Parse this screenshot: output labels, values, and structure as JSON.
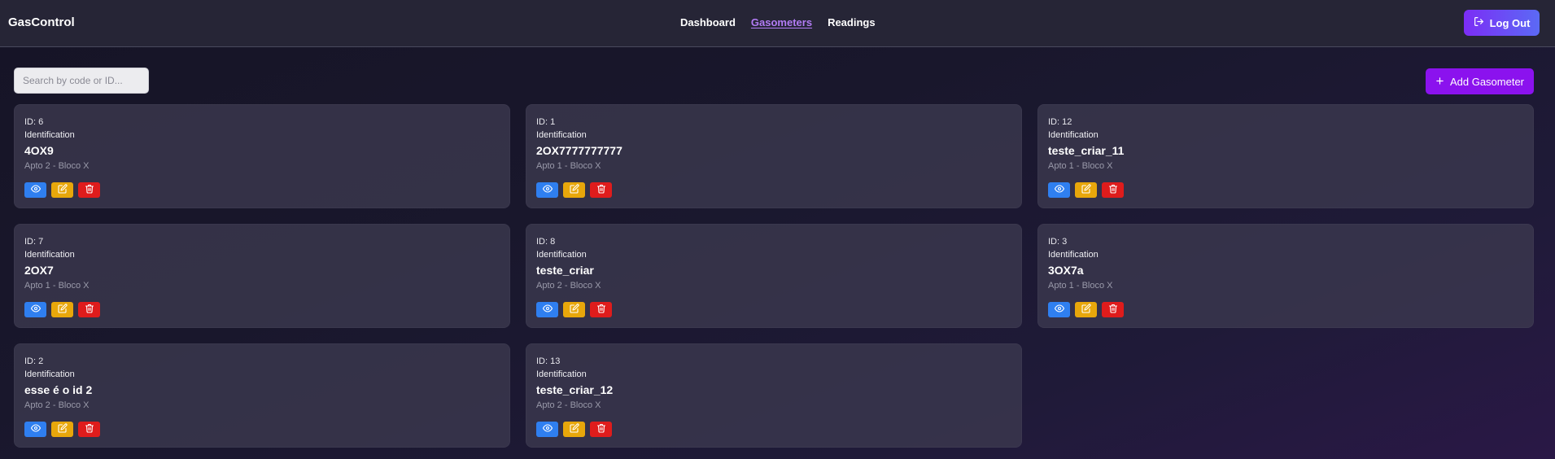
{
  "app": {
    "brand": "GasControl"
  },
  "nav": {
    "items": [
      {
        "label": "Dashboard",
        "active": false
      },
      {
        "label": "Gasometers",
        "active": true
      },
      {
        "label": "Readings",
        "active": false
      }
    ]
  },
  "header": {
    "logout_label": "Log Out",
    "logout_icon": "log-out-icon"
  },
  "toolbar": {
    "search_placeholder": "Search by code or ID...",
    "search_value": "",
    "add_label": "Add Gasometer",
    "add_icon": "plus-icon"
  },
  "colors": {
    "accent": "#8b12ee",
    "view": "#2f7ff0",
    "edit": "#e8a70b",
    "delete": "#df1c1c",
    "active_nav": "#b37cf5"
  },
  "cards": [
    {
      "id": "ID: 6",
      "ident_label": "Identification",
      "code": "4OX9",
      "location": "Apto 2 - Bloco X"
    },
    {
      "id": "ID: 1",
      "ident_label": "Identification",
      "code": "2OX7777777777",
      "location": "Apto 1 - Bloco X"
    },
    {
      "id": "ID: 12",
      "ident_label": "Identification",
      "code": "teste_criar_11",
      "location": "Apto 1 - Bloco X"
    },
    {
      "id": "ID: 7",
      "ident_label": "Identification",
      "code": "2OX7",
      "location": "Apto 1 - Bloco X"
    },
    {
      "id": "ID: 8",
      "ident_label": "Identification",
      "code": "teste_criar",
      "location": "Apto 2 - Bloco X"
    },
    {
      "id": "ID: 3",
      "ident_label": "Identification",
      "code": "3OX7a",
      "location": "Apto 1 - Bloco X"
    },
    {
      "id": "ID: 2",
      "ident_label": "Identification",
      "code": "esse é o id 2",
      "location": "Apto 2 - Bloco X"
    },
    {
      "id": "ID: 13",
      "ident_label": "Identification",
      "code": "teste_criar_12",
      "location": "Apto 2 - Bloco X"
    }
  ],
  "card_actions": {
    "view_icon": "eye-icon",
    "edit_icon": "edit-icon",
    "delete_icon": "trash-icon"
  }
}
